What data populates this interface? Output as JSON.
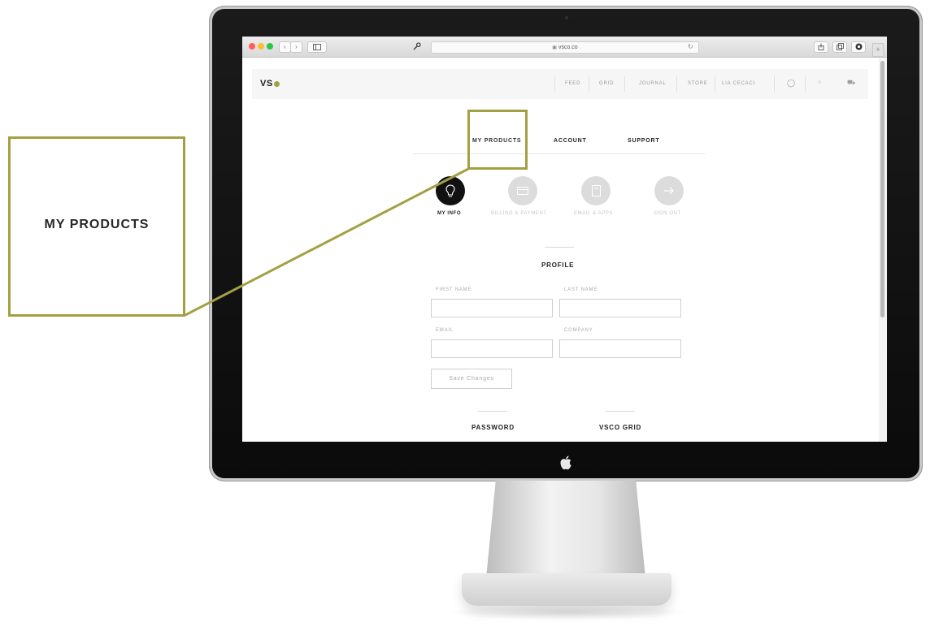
{
  "browser": {
    "address": "vsco.co",
    "back_glyph": "‹",
    "forward_glyph": "›",
    "new_tab_glyph": "+",
    "icons": [
      "back-icon",
      "forward-icon",
      "sidebar-icon",
      "wrench-icon",
      "lock-icon",
      "reload-icon",
      "share-icon",
      "tabs-icon",
      "extension-icon"
    ]
  },
  "site": {
    "logo_text": "VS",
    "logo_accent_color": "#a3a044",
    "nav": [
      "FEED",
      "GRID",
      "JOURNAL",
      "STORE",
      "LIA CECACI"
    ],
    "nav_icons": [
      "profile-icon",
      "loading-icon",
      "cart-icon"
    ]
  },
  "account_tabs": [
    "MY PRODUCTS",
    "ACCOUNT",
    "SUPPORT"
  ],
  "sections": [
    {
      "label": "MY INFO",
      "icon": "lightbulb-icon",
      "active": true
    },
    {
      "label": "BILLING & PAYMENT",
      "icon": "credit-card-icon",
      "active": false
    },
    {
      "label": "EMAIL & APPS",
      "icon": "document-icon",
      "active": false
    },
    {
      "label": "SIGN OUT",
      "icon": "arrow-right-icon",
      "active": false
    }
  ],
  "profile": {
    "title": "PROFILE",
    "first_name_label": "FIRST NAME",
    "last_name_label": "LAST NAME",
    "email_label": "EMAIL",
    "company_label": "COMPANY",
    "first_name_value": "",
    "last_name_value": "",
    "email_value": "",
    "company_value": "",
    "save_label": "Save Changes"
  },
  "lower_sections": [
    "PASSWORD",
    "VSCO GRID"
  ],
  "callout": {
    "text": "MY PRODUCTS",
    "color": "#a3a044"
  }
}
